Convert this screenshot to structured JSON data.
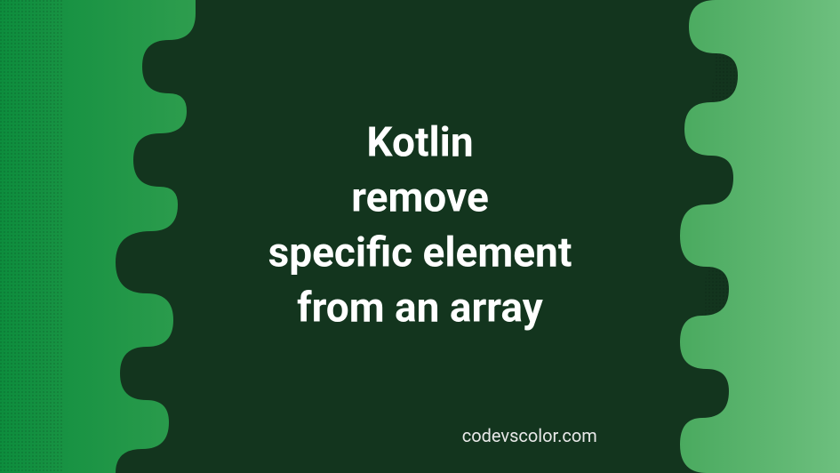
{
  "banner": {
    "title_line1": "Kotlin",
    "title_line2": "remove",
    "title_line3": "specific element",
    "title_line4": "from an array",
    "website": "codevscolor.com"
  },
  "colors": {
    "background_dark": "#13351e",
    "accent_green_dark": "#0d8d3d",
    "accent_green_light": "#5eb571",
    "text": "#ffffff"
  }
}
